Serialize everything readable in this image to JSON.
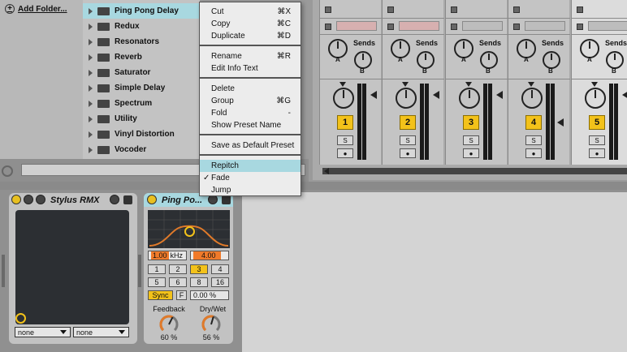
{
  "browser": {
    "add_folder_label": "Add Folder...",
    "items": [
      {
        "label": "Ping Pong Delay",
        "selected": true
      },
      {
        "label": "Redux"
      },
      {
        "label": "Resonators"
      },
      {
        "label": "Reverb"
      },
      {
        "label": "Saturator"
      },
      {
        "label": "Simple Delay"
      },
      {
        "label": "Spectrum"
      },
      {
        "label": "Utility"
      },
      {
        "label": "Vinyl Distortion"
      },
      {
        "label": "Vocoder"
      }
    ]
  },
  "context_menu": {
    "items": [
      {
        "label": "Cut",
        "shortcut": "⌘X"
      },
      {
        "label": "Copy",
        "shortcut": "⌘C"
      },
      {
        "label": "Duplicate",
        "shortcut": "⌘D"
      },
      {
        "label": "Rename",
        "shortcut": "⌘R"
      },
      {
        "label": "Edit Info Text",
        "shortcut": ""
      },
      {
        "label": "Delete",
        "shortcut": ""
      },
      {
        "label": "Group",
        "shortcut": "⌘G"
      },
      {
        "label": "Fold",
        "shortcut": "-"
      },
      {
        "label": "Show Preset Name",
        "shortcut": ""
      },
      {
        "label": "Save as Default Preset",
        "shortcut": ""
      },
      {
        "label": "Repitch",
        "shortcut": "",
        "highlighted": true
      },
      {
        "label": "Fade",
        "shortcut": "",
        "checked": true
      },
      {
        "label": "Jump",
        "shortcut": ""
      }
    ]
  },
  "mixer": {
    "sends_label": "Sends",
    "send_a": "A",
    "send_b": "B",
    "solo_label": "S",
    "tracks": [
      "1",
      "2",
      "3",
      "4",
      "5"
    ],
    "accent": "#f3c21a"
  },
  "devices": {
    "stylus": {
      "title": "Stylus RMX",
      "select_left": "none",
      "select_right": "none"
    },
    "pingpong": {
      "title": "Ping Po...",
      "freq_value": "1.00",
      "freq_unit": "kHz",
      "width_value": "4.00",
      "divisions_row1": [
        "1",
        "2",
        "3",
        "4"
      ],
      "divisions_row2": [
        "5",
        "6",
        "8",
        "16"
      ],
      "active_division": "3",
      "sync_label": "Sync",
      "f_label": "F",
      "offset_value": "0.00 %",
      "feedback_label": "Feedback",
      "feedback_value": "60 %",
      "feedback_level": 0.6,
      "drywet_label": "Dry/Wet",
      "drywet_value": "56 %",
      "drywet_level": 0.56
    }
  }
}
